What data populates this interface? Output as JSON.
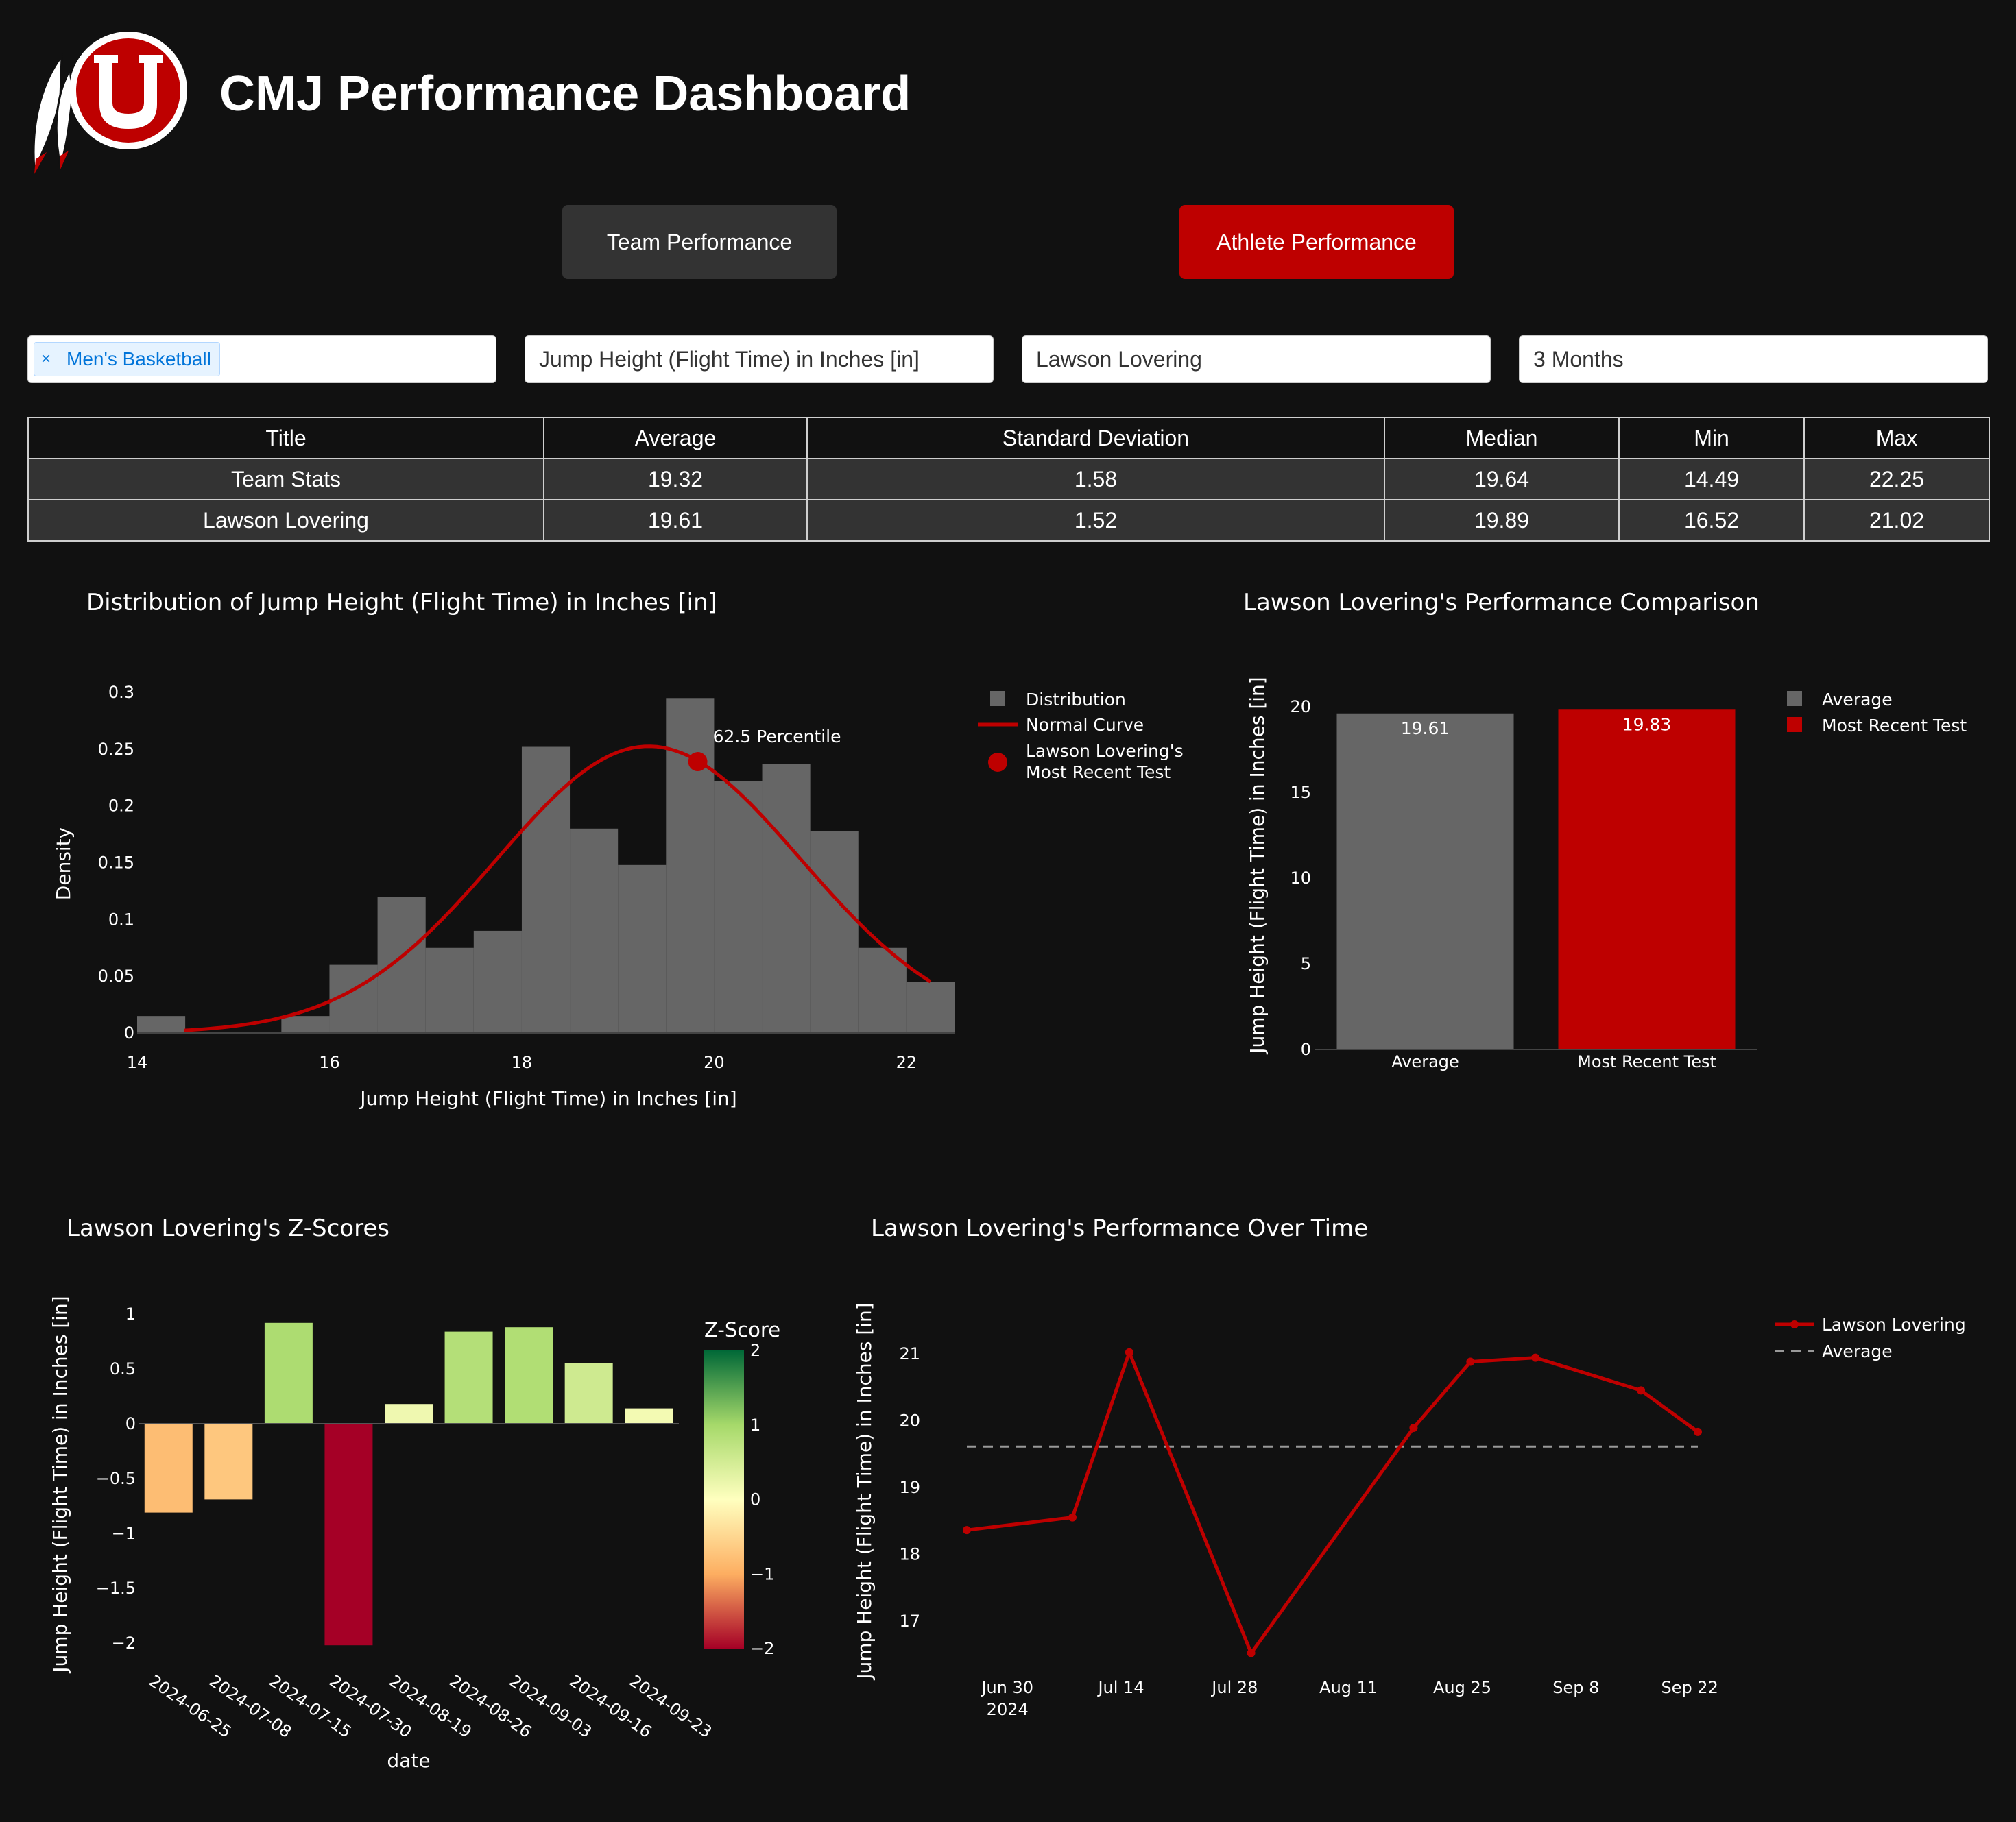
{
  "header": {
    "title": "CMJ Performance Dashboard",
    "logo": "utah-utes-drum-and-feathers-logo"
  },
  "tabs": [
    {
      "label": "Team Performance",
      "active": false,
      "color": "#333333"
    },
    {
      "label": "Athlete Performance",
      "active": true,
      "color": "#BE0000"
    }
  ],
  "filters": {
    "team": {
      "chips": [
        "Men's Basketball"
      ],
      "remove_glyph": "×"
    },
    "metric": "Jump Height (Flight Time) in Inches [in]",
    "athlete": "Lawson Lovering",
    "period": "3 Months"
  },
  "stats_table": {
    "headers": [
      "Title",
      "Average",
      "Standard Deviation",
      "Median",
      "Min",
      "Max"
    ],
    "rows": [
      [
        "Team Stats",
        "19.32",
        "1.58",
        "19.64",
        "14.49",
        "22.25"
      ],
      [
        "Lawson Lovering",
        "19.61",
        "1.52",
        "19.89",
        "16.52",
        "21.02"
      ]
    ]
  },
  "colors": {
    "accent": "#BE0000",
    "bar_gray": "#666666",
    "background": "#111111"
  },
  "chart_data": [
    {
      "type": "bar",
      "title": "Distribution of Jump Height (Flight Time) in Inches [in]",
      "xlabel": "Jump Height (Flight Time) in Inches [in]",
      "ylabel": "Density",
      "xlim": [
        14,
        22.5
      ],
      "ylim": [
        0,
        0.3
      ],
      "x_ticks": [
        "14",
        "16",
        "18",
        "20",
        "22"
      ],
      "y_ticks": [
        "0",
        "0.05",
        "0.1",
        "0.15",
        "0.2",
        "0.25",
        "0.3"
      ],
      "bins": [
        {
          "start": 14.0,
          "end": 14.5,
          "density": 0.015
        },
        {
          "start": 14.5,
          "end": 15.0,
          "density": 0.0
        },
        {
          "start": 15.0,
          "end": 15.5,
          "density": 0.0
        },
        {
          "start": 15.5,
          "end": 16.0,
          "density": 0.015
        },
        {
          "start": 16.0,
          "end": 16.5,
          "density": 0.06
        },
        {
          "start": 16.5,
          "end": 17.0,
          "density": 0.12
        },
        {
          "start": 17.0,
          "end": 17.5,
          "density": 0.075
        },
        {
          "start": 17.5,
          "end": 18.0,
          "density": 0.09
        },
        {
          "start": 18.0,
          "end": 18.5,
          "density": 0.252
        },
        {
          "start": 18.5,
          "end": 19.0,
          "density": 0.18
        },
        {
          "start": 19.0,
          "end": 19.5,
          "density": 0.148
        },
        {
          "start": 19.5,
          "end": 20.0,
          "density": 0.295
        },
        {
          "start": 20.0,
          "end": 20.5,
          "density": 0.222
        },
        {
          "start": 20.5,
          "end": 21.0,
          "density": 0.237
        },
        {
          "start": 21.0,
          "end": 21.5,
          "density": 0.178
        },
        {
          "start": 21.5,
          "end": 22.0,
          "density": 0.075
        },
        {
          "start": 22.0,
          "end": 22.5,
          "density": 0.045
        }
      ],
      "normal_curve": {
        "mean": 19.32,
        "sd": 1.58,
        "x_range": [
          14.49,
          22.25
        ]
      },
      "marker": {
        "x": 19.83,
        "y": 0.239,
        "label": "62.5 Percentile"
      },
      "legend": {
        "placement": "right",
        "items": [
          "Distribution",
          "Normal Curve",
          "Lawson Lovering's",
          "Most Recent Test"
        ]
      }
    },
    {
      "type": "bar",
      "title": "Lawson Lovering's Performance Comparison",
      "ylabel": "Jump Height (Flight Time) in Inches [in]",
      "categories": [
        "Average",
        "Most Recent Test"
      ],
      "values": [
        19.61,
        19.83
      ],
      "value_labels": [
        "19.61",
        "19.83"
      ],
      "bar_colors": [
        "#666666",
        "#BE0000"
      ],
      "ylim": [
        0,
        21
      ],
      "y_ticks": [
        "0",
        "5",
        "10",
        "15",
        "20"
      ],
      "legend": {
        "placement": "right",
        "items": [
          "Average",
          "Most Recent Test"
        ]
      }
    },
    {
      "type": "bar",
      "title": "Lawson Lovering's Z-Scores",
      "xlabel": "date",
      "ylabel": "Jump Height (Flight Time) in Inches [in]",
      "categories": [
        "2024-06-25",
        "2024-07-08",
        "2024-07-15",
        "2024-07-30",
        "2024-08-19",
        "2024-08-26",
        "2024-09-03",
        "2024-09-16",
        "2024-09-23"
      ],
      "values": [
        -0.81,
        -0.69,
        0.92,
        -2.02,
        0.18,
        0.84,
        0.88,
        0.55,
        0.14
      ],
      "ylim": [
        -2.1,
        1.15
      ],
      "y_ticks": [
        "1",
        "0.5",
        "0",
        "−0.5",
        "−1",
        "−1.5",
        "−2"
      ],
      "colorbar": {
        "title": "Z-Score",
        "range": [
          -2,
          2
        ],
        "ticks": [
          "2",
          "1",
          "0",
          "−1",
          "−2"
        ]
      }
    },
    {
      "type": "line",
      "title": "Lawson Lovering's Performance Over Time",
      "ylabel": "Jump Height (Flight Time) in Inches [in]",
      "x_ticks": [
        "Jun 30",
        "Jul 14",
        "Jul 28",
        "Aug 11",
        "Aug 25",
        "Sep 8",
        "Sep 22"
      ],
      "x_tick_subtitle": "2024",
      "y_ticks": [
        "17",
        "18",
        "19",
        "20",
        "21"
      ],
      "ylim": [
        16.3,
        21.5
      ],
      "series": [
        {
          "name": "Lawson Lovering",
          "x": [
            "2024-06-25",
            "2024-07-08",
            "2024-07-15",
            "2024-07-30",
            "2024-08-19",
            "2024-08-26",
            "2024-09-03",
            "2024-09-16",
            "2024-09-23"
          ],
          "y": [
            18.36,
            18.55,
            21.02,
            16.52,
            19.89,
            20.88,
            20.94,
            20.45,
            19.83
          ]
        },
        {
          "name": "Average",
          "constant": 19.61,
          "x_range": [
            "2024-06-25",
            "2024-09-23"
          ]
        }
      ],
      "legend": {
        "placement": "top-right",
        "items": [
          "Lawson Lovering",
          "Average"
        ]
      }
    }
  ]
}
